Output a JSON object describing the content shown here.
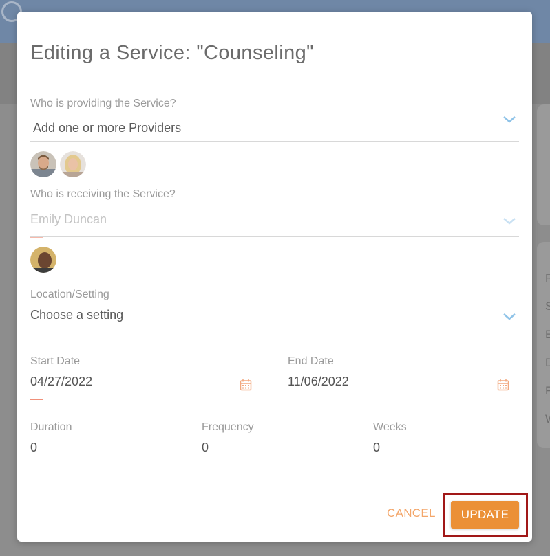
{
  "modal": {
    "title": "Editing a Service: \"Counseling\""
  },
  "providers": {
    "label": "Who is providing the Service?",
    "placeholder": "Add one or more Providers",
    "avatars": [
      "provider-avatar-man",
      "provider-avatar-woman"
    ]
  },
  "recipient": {
    "label": "Who is receiving the Service?",
    "value": "Emily Duncan",
    "avatars": [
      "recipient-avatar"
    ]
  },
  "location": {
    "label": "Location/Setting",
    "value": "Choose a setting"
  },
  "start_date": {
    "label": "Start Date",
    "value": "04/27/2022"
  },
  "end_date": {
    "label": "End Date",
    "value": "11/06/2022"
  },
  "duration": {
    "label": "Duration",
    "value": "0"
  },
  "frequency": {
    "label": "Frequency",
    "value": "0"
  },
  "weeks": {
    "label": "Weeks",
    "value": "0"
  },
  "actions": {
    "cancel_label": "CANCEL",
    "update_label": "UPDATE"
  },
  "colors": {
    "accent_orange": "#eb9036",
    "cancel_text": "#f3a66a",
    "chevron_blue": "#8fc3e8",
    "focus_underline": "#f0907a",
    "highlight_box": "#a11818"
  },
  "background_letters": [
    "R",
    "S",
    "E",
    "D",
    "F",
    "W"
  ]
}
